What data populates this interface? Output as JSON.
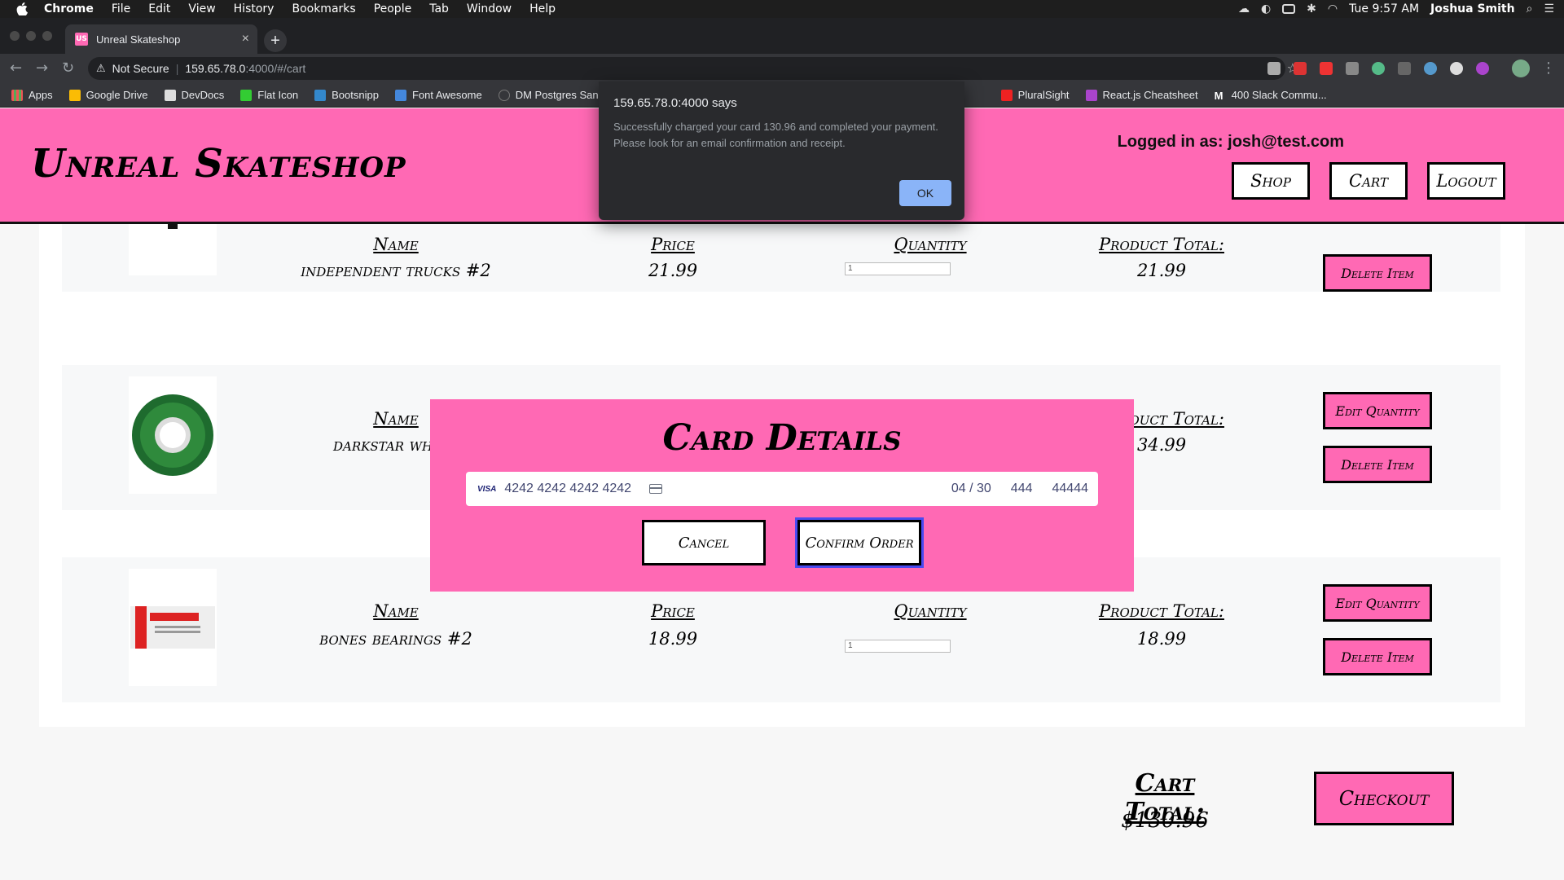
{
  "menubar": {
    "app": "Chrome",
    "items": [
      "File",
      "Edit",
      "View",
      "History",
      "Bookmarks",
      "People",
      "Tab",
      "Window",
      "Help"
    ],
    "clock": "Tue 9:57 AM",
    "user": "Joshua Smith"
  },
  "browser": {
    "tab_title": "Unreal Skateshop",
    "tab_favicon": "US",
    "security_label": "Not Secure",
    "url_host": "159.65.78.0",
    "url_path": ":4000/#/cart",
    "bookmarks": [
      "Apps",
      "Google Drive",
      "DevDocs",
      "Flat Icon",
      "Bootsnipp",
      "Font Awesome",
      "DM Postgres Sand...",
      "PluralSight",
      "React.js Cheatsheet",
      "400 Slack Commu..."
    ]
  },
  "alert": {
    "title": "159.65.78.0:4000 says",
    "message": "Successfully charged your card 130.96 and completed your payment. Please look for an email confirmation and receipt.",
    "ok_label": "OK"
  },
  "site": {
    "logo": "Unreal Skateshop",
    "logged_in": "Logged in as: josh@test.com",
    "nav": {
      "shop": "Shop",
      "cart": "Cart",
      "logout": "Logout"
    },
    "brand_color": "#ff69b4"
  },
  "cart": {
    "labels": {
      "name": "Name",
      "price": "Price",
      "quantity": "Quantity",
      "product_total": "Product Total:"
    },
    "edit_label": "Edit Quantity",
    "delete_label": "Delete Item",
    "items": [
      {
        "name": "independent trucks #2",
        "price": "21.99",
        "quantity": "1",
        "total": "21.99"
      },
      {
        "name": "darkstar wheel",
        "price": "",
        "quantity": "",
        "total": "34.99"
      },
      {
        "name": "bones bearings #2",
        "price": "18.99",
        "quantity": "1",
        "total": "18.99"
      }
    ],
    "total_label": "Cart Total:",
    "total_value": "$130.96",
    "checkout_label": "Checkout"
  },
  "card_modal": {
    "title": "Card Details",
    "brand": "VISA",
    "card_number": "4242 4242 4242 4242",
    "expiry": "04 / 30",
    "cvc": "444",
    "zip": "44444",
    "cancel_label": "Cancel",
    "confirm_label": "Confirm Order"
  }
}
